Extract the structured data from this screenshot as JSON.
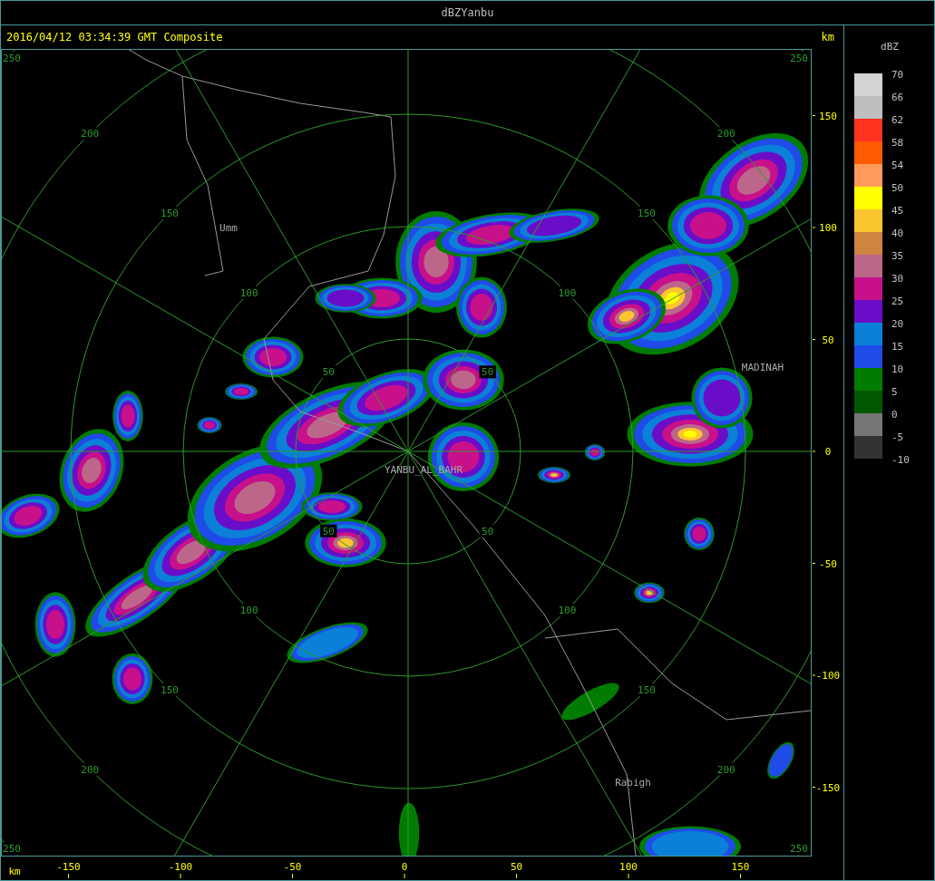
{
  "window": {
    "title": "dBZYanbu"
  },
  "header": {
    "timestamp": "2016/04/12 03:34:39 GMT Composite",
    "unit": "km"
  },
  "plot": {
    "rings": [
      {
        "labels": [
          "50",
          "50",
          "50",
          "50"
        ]
      },
      {
        "labels": [
          "100",
          "100",
          "100",
          "100"
        ]
      },
      {
        "labels": [
          "150",
          "150",
          "150",
          "150"
        ]
      },
      {
        "labels": [
          "200",
          "200",
          "200",
          "200"
        ]
      },
      {
        "labels": [
          "250",
          "250",
          "250",
          "250"
        ]
      }
    ],
    "places": [
      {
        "name": "Umm"
      },
      {
        "name": "YANBU_AL_BAHR"
      },
      {
        "name": "MADINAH"
      },
      {
        "name": "Rabigh"
      }
    ],
    "x_axis": {
      "unit": "km",
      "ticks": [
        "-150",
        "-100",
        "-50",
        "0",
        "50",
        "100",
        "150"
      ]
    },
    "y_axis": {
      "ticks": [
        "150",
        "100",
        "50",
        "0",
        "-50",
        "-100",
        "-150"
      ]
    }
  },
  "legend": {
    "title": "dBZ",
    "bins": [
      {
        "label": "70",
        "color": "#d3d3d3"
      },
      {
        "label": "66",
        "color": "#bebebe"
      },
      {
        "label": "62",
        "color": "#ff3320"
      },
      {
        "label": "58",
        "color": "#ff5a00"
      },
      {
        "label": "54",
        "color": "#ff9a5a"
      },
      {
        "label": "50",
        "color": "#ffff00"
      },
      {
        "label": "45",
        "color": "#fbc52f"
      },
      {
        "label": "40",
        "color": "#cd853f"
      },
      {
        "label": "35",
        "color": "#bc678a"
      },
      {
        "label": "30",
        "color": "#c8108b"
      },
      {
        "label": "25",
        "color": "#6a0dc8"
      },
      {
        "label": "20",
        "color": "#0a80d8"
      },
      {
        "label": "15",
        "color": "#1f4be8"
      },
      {
        "label": "10",
        "color": "#007d00"
      },
      {
        "label": "5",
        "color": "#005800"
      },
      {
        "label": "0",
        "color": "#777777"
      },
      {
        "label": "-5",
        "color": "#333333"
      }
    ],
    "bottom_label": "-10"
  }
}
